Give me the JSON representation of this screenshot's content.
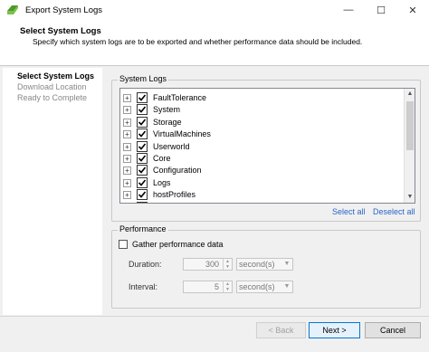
{
  "window": {
    "title": "Export System Logs",
    "controls": {
      "minimize": "—",
      "maximize": "☐",
      "close": "✕"
    }
  },
  "header": {
    "title": "Select System Logs",
    "description": "Specify which system logs are to be exported and whether performance data should be included."
  },
  "nav": {
    "items": [
      {
        "label": "Select System Logs",
        "state": "active"
      },
      {
        "label": "Download Location",
        "state": "inactive"
      },
      {
        "label": "Ready to Complete",
        "state": "inactive"
      }
    ]
  },
  "system_logs": {
    "group_label": "System Logs",
    "items": [
      {
        "label": "FaultTolerance",
        "checked": true,
        "expander": "+"
      },
      {
        "label": "System",
        "checked": true,
        "expander": "+"
      },
      {
        "label": "Storage",
        "checked": true,
        "expander": "+"
      },
      {
        "label": "VirtualMachines",
        "checked": true,
        "expander": "+"
      },
      {
        "label": "Userworld",
        "checked": true,
        "expander": "+"
      },
      {
        "label": "Core",
        "checked": true,
        "expander": "+"
      },
      {
        "label": "Configuration",
        "checked": true,
        "expander": "+"
      },
      {
        "label": "Logs",
        "checked": true,
        "expander": "+"
      },
      {
        "label": "hostProfiles",
        "checked": true,
        "expander": "+"
      },
      {
        "label": "FileSystem",
        "checked": true,
        "expander": "+"
      }
    ],
    "select_all": "Select all",
    "deselect_all": "Deselect all"
  },
  "performance": {
    "group_label": "Performance",
    "gather_label": "Gather performance data",
    "gather_checked": false,
    "duration_label": "Duration:",
    "duration_value": "300",
    "duration_unit": "second(s)",
    "interval_label": "Interval:",
    "interval_value": "5",
    "interval_unit": "second(s)"
  },
  "footer": {
    "back": "< Back",
    "next": "Next >",
    "cancel": "Cancel"
  },
  "colors": {
    "link": "#2a64c8",
    "primary_border": "#0078d7",
    "app_icon": "#4c9a2a"
  }
}
